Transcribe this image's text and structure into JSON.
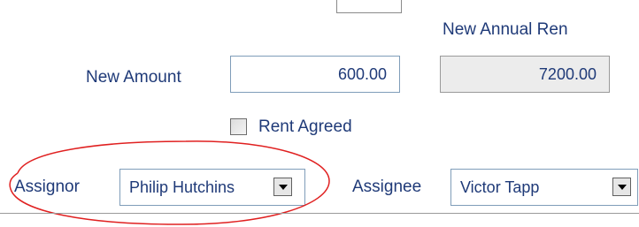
{
  "renewal": {
    "annual_label": "New Annual Ren",
    "amount_label": "New Amount",
    "amount_value": "600.00",
    "annual_value": "7200.00"
  },
  "rent_agreed": {
    "label": "Rent Agreed",
    "checked": false
  },
  "assignment": {
    "assignor_label": "Assignor",
    "assignor_value": "Philip Hutchins",
    "assignee_label": "Assignee",
    "assignee_value": "Victor Tapp"
  },
  "annotation": {
    "color": "#e02020"
  },
  "icons": {
    "dropdown": "chevron-down-icon"
  }
}
